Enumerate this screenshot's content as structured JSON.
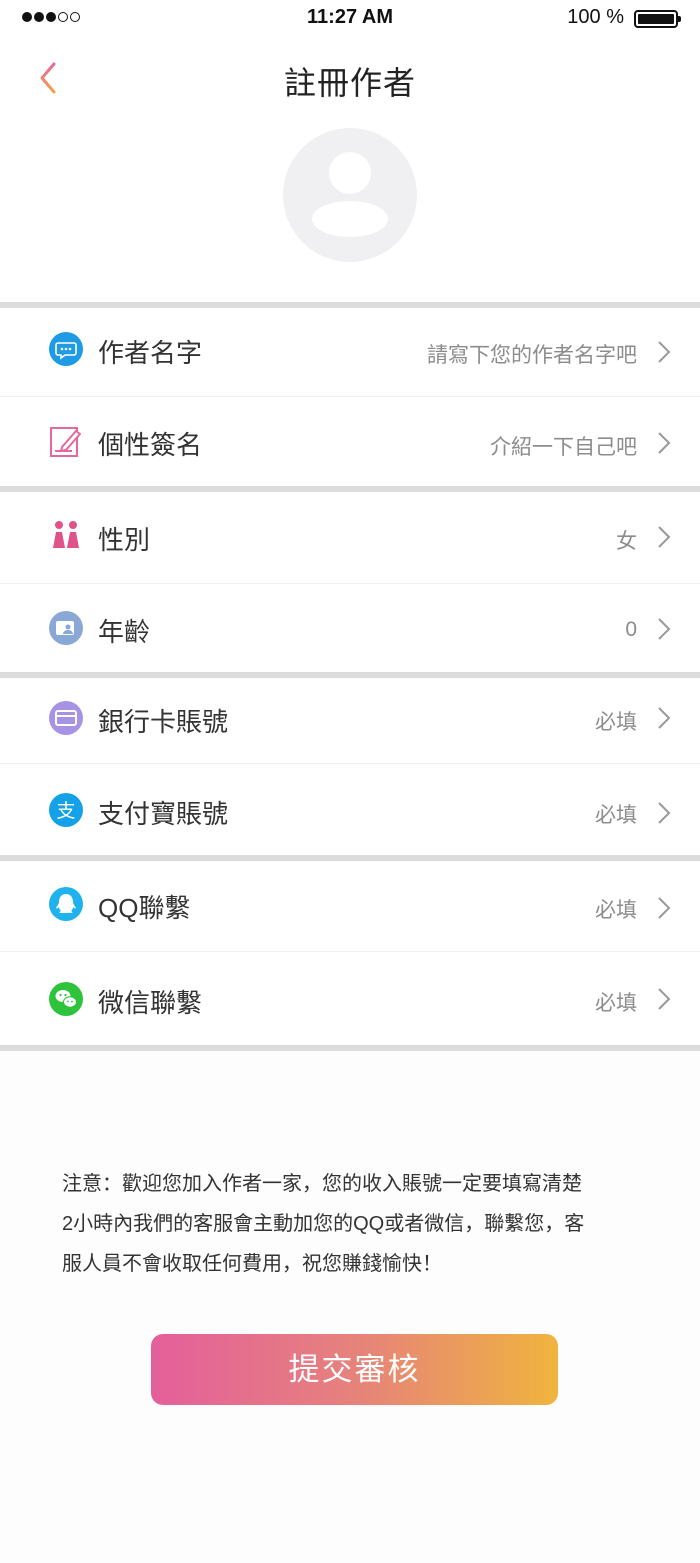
{
  "status_bar": {
    "time": "11:27 AM",
    "battery": "100 %"
  },
  "nav": {
    "title": "註冊作者"
  },
  "rows": [
    {
      "label": "作者名字",
      "value": "請寫下您的作者名字吧",
      "icon": "chat-bubble-icon",
      "color": "#1e9be4"
    },
    {
      "label": "個性簽名",
      "value": "介紹一下自己吧",
      "icon": "pencil-note-icon",
      "color": "#e4689e"
    },
    {
      "label": "性別",
      "value": "女",
      "icon": "gender-people-icon",
      "color": "#e0528a"
    },
    {
      "label": "年齡",
      "value": "0",
      "icon": "id-card-icon",
      "color": "#8aa8d6"
    },
    {
      "label": "銀行卡賬號",
      "value": "必填",
      "icon": "bank-card-icon",
      "color": "#a693e6"
    },
    {
      "label": "支付寶賬號",
      "value": "必填",
      "icon": "alipay-icon",
      "color": "#15a1e8"
    },
    {
      "label": "QQ聯繫",
      "value": "必填",
      "icon": "qq-icon",
      "color": "#1fb2ef"
    },
    {
      "label": "微信聯繫",
      "value": "必填",
      "icon": "wechat-icon",
      "color": "#2dc43b"
    }
  ],
  "notice": {
    "line1": "注意：歡迎您加入作者一家，您的收入賬號一定要填寫清楚",
    "line2": "2小時內我們的客服會主動加您的QQ或者微信，聯繫您，客",
    "line3": "服人員不會收取任何費用，祝您賺錢愉快！"
  },
  "submit": {
    "label": "提交審核"
  }
}
